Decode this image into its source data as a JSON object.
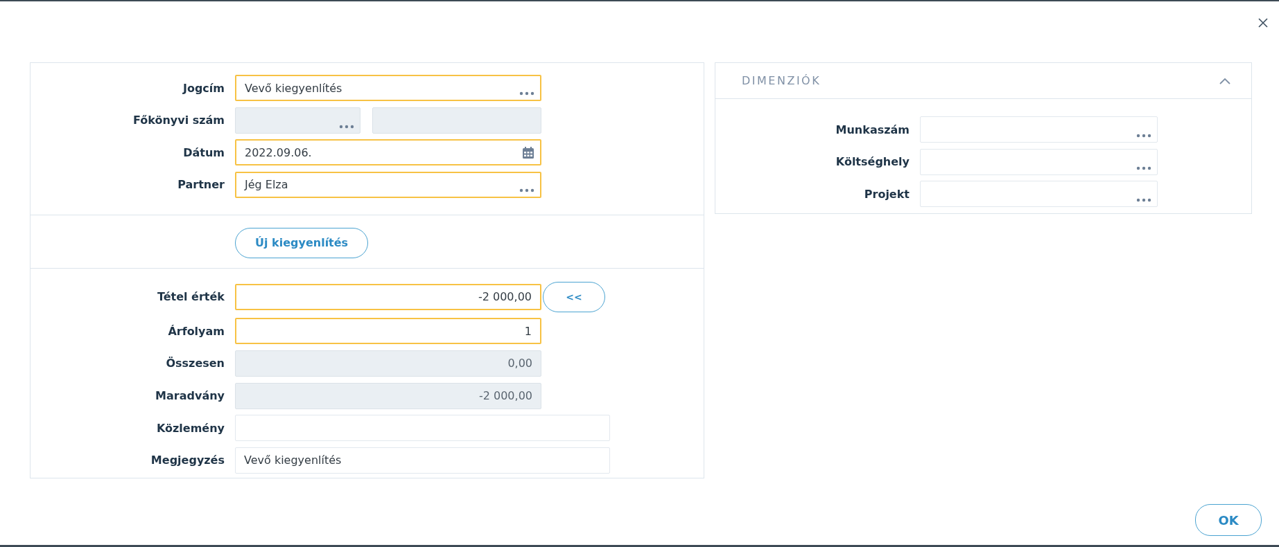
{
  "header_form": {
    "rows": [
      {
        "label": "Jogcím",
        "fields": [
          {
            "kind": "lookup",
            "value": "Vevő kiegyenlítés",
            "required": true,
            "disabled": false
          }
        ]
      },
      {
        "label": "Főkönyvi szám",
        "fields": [
          {
            "kind": "lookup",
            "required": false,
            "disabled": true
          },
          {
            "kind": "text",
            "required": false,
            "disabled": true
          }
        ]
      },
      {
        "label": "Dátum",
        "fields": [
          {
            "kind": "date",
            "value": "2022.09.06.",
            "required": true,
            "disabled": false
          }
        ]
      },
      {
        "label": "Partner",
        "fields": [
          {
            "kind": "lookup",
            "value": "Jég Elza",
            "required": true,
            "disabled": false
          }
        ]
      }
    ]
  },
  "new_button": "Új kiegyenlítés",
  "amount_form": {
    "rows": [
      {
        "label": "Tétel érték",
        "fields": [
          {
            "kind": "number",
            "value": "-2 000,00",
            "required": true,
            "disabled": false
          }
        ],
        "action": "<<"
      },
      {
        "label": "Árfolyam",
        "fields": [
          {
            "kind": "number",
            "value": "1",
            "required": true,
            "disabled": false
          }
        ]
      },
      {
        "label": "Összesen",
        "fields": [
          {
            "kind": "number",
            "value": "0,00",
            "required": false,
            "disabled": true
          }
        ]
      },
      {
        "label": "Maradvány",
        "fields": [
          {
            "kind": "number",
            "value": "-2 000,00",
            "required": false,
            "disabled": true
          }
        ]
      },
      {
        "label": "Közlemény",
        "fields": [
          {
            "kind": "text",
            "required": false,
            "disabled": false
          }
        ]
      },
      {
        "label": "Megjegyzés",
        "fields": [
          {
            "kind": "text",
            "value": "Vevő kiegyenlítés",
            "required": false,
            "disabled": false
          }
        ]
      }
    ]
  },
  "dimensions": {
    "title": "DIMENZIÓK",
    "expanded": true,
    "rows": [
      {
        "label": "Munkaszám",
        "fields": [
          {
            "kind": "lookup",
            "required": false,
            "disabled": false
          }
        ]
      },
      {
        "label": "Költséghely",
        "fields": [
          {
            "kind": "lookup",
            "required": false,
            "disabled": false
          }
        ]
      },
      {
        "label": "Projekt",
        "fields": [
          {
            "kind": "lookup",
            "required": false,
            "disabled": false
          }
        ]
      }
    ]
  },
  "ok_button": "OK"
}
